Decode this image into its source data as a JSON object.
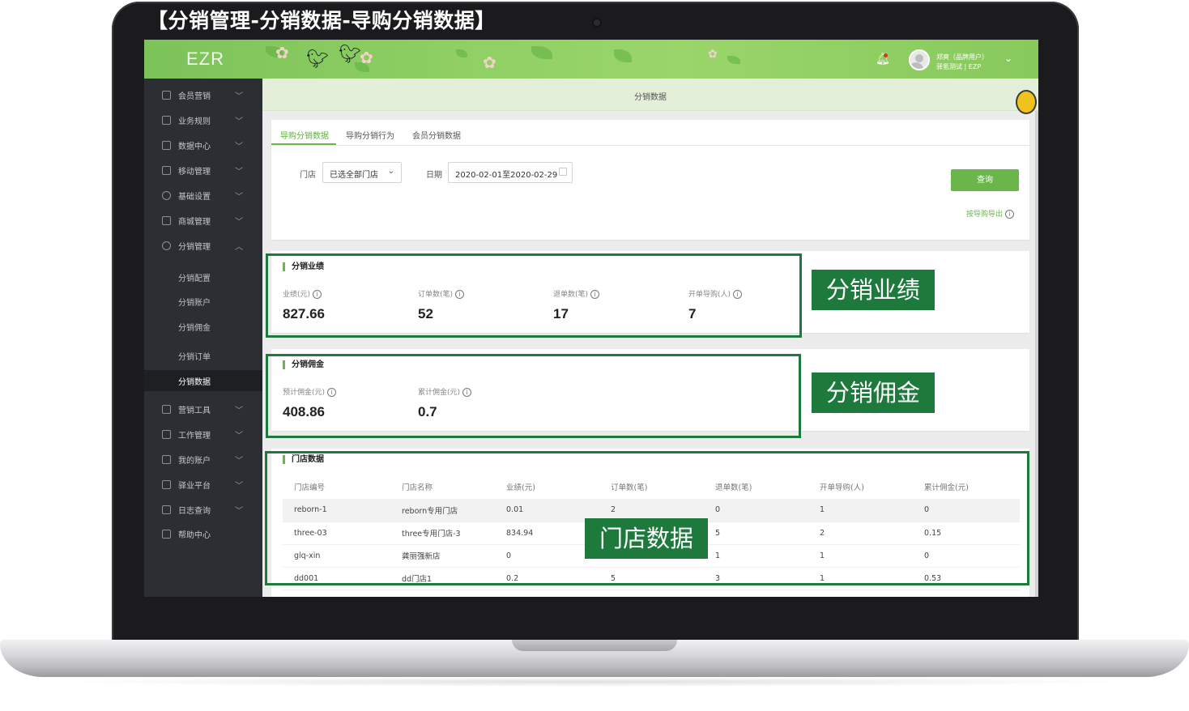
{
  "heading": "【分销管理-分销数据-导购分销数据】",
  "app": {
    "logo": "EZR",
    "user_name": "郑爽（品牌用户）",
    "user_org": "驿氪测试 | EZP"
  },
  "sidebar": {
    "items": [
      {
        "label": "会员营销",
        "icon": "member-marketing-icon"
      },
      {
        "label": "业务规则",
        "icon": "business-rules-icon"
      },
      {
        "label": "数据中心",
        "icon": "data-center-icon"
      },
      {
        "label": "移动管理",
        "icon": "mobile-icon"
      },
      {
        "label": "基础设置",
        "icon": "settings-icon"
      },
      {
        "label": "商城管理",
        "icon": "store-icon"
      },
      {
        "label": "分销管理",
        "icon": "distribution-icon"
      }
    ],
    "sub_items": [
      {
        "label": "分销配置"
      },
      {
        "label": "分销账户"
      },
      {
        "label": "分销佣金"
      },
      {
        "label": "分销订单"
      },
      {
        "label": "分销数据"
      }
    ],
    "items_bottom": [
      {
        "label": "营销工具",
        "icon": "marketing-tools-icon"
      },
      {
        "label": "工作管理",
        "icon": "work-icon"
      },
      {
        "label": "我的账户",
        "icon": "account-icon"
      },
      {
        "label": "驿业平台",
        "icon": "platform-icon"
      },
      {
        "label": "日志查询",
        "icon": "log-icon"
      },
      {
        "label": "帮助中心",
        "icon": "help-icon"
      }
    ]
  },
  "page": {
    "title": "分销数据",
    "tabs": [
      {
        "label": "导购分销数据",
        "active": true
      },
      {
        "label": "导购分销行为",
        "active": false
      },
      {
        "label": "会员分销数据",
        "active": false
      }
    ],
    "filters": {
      "store_label": "门店",
      "store_value": "已选全部门店",
      "date_label": "日期",
      "date_value": "2020-02-01至2020-02-29"
    },
    "query_button": "查询",
    "export_link": "按导购导出"
  },
  "performance": {
    "title": "分销业绩",
    "stats": [
      {
        "label": "业绩(元)",
        "value": "827.66"
      },
      {
        "label": "订单数(笔)",
        "value": "52"
      },
      {
        "label": "退单数(笔)",
        "value": "17"
      },
      {
        "label": "开单导购(人)",
        "value": "7"
      }
    ]
  },
  "commission": {
    "title": "分销佣金",
    "stats": [
      {
        "label": "预计佣金(元)",
        "value": "408.86"
      },
      {
        "label": "累计佣金(元)",
        "value": "0.7"
      }
    ]
  },
  "store_data": {
    "title": "门店数据",
    "columns": [
      "门店编号",
      "门店名称",
      "业绩(元)",
      "订单数(笔)",
      "退单数(笔)",
      "开单导购(人)",
      "累计佣金(元)"
    ],
    "rows": [
      [
        "reborn-1",
        "reborn专用门店",
        "0.01",
        "2",
        "0",
        "1",
        "0"
      ],
      [
        "three-03",
        "three专用门店-3",
        "834.94",
        "",
        "5",
        "2",
        "0.15"
      ],
      [
        "glq-xin",
        "龚丽强新店",
        "0",
        "",
        "1",
        "1",
        "0"
      ],
      [
        "dd001",
        "dd门店1",
        "0.2",
        "5",
        "3",
        "1",
        "0.53"
      ]
    ]
  },
  "annotations": {
    "performance_tag": "分销业绩",
    "commission_tag": "分销佣金",
    "store_tag": "门店数据"
  },
  "colors": {
    "accent": "#6ab64a",
    "annotation": "#1d7a3c",
    "sidebar": "#2b2e32"
  }
}
